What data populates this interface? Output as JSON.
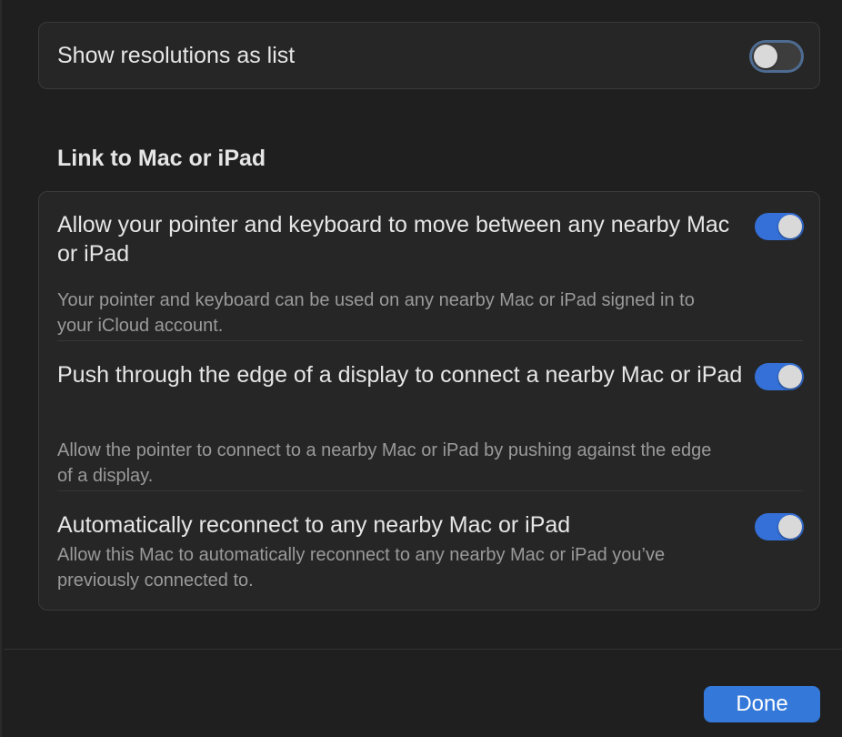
{
  "display": {
    "show_resolutions_label": "Show resolutions as list",
    "show_resolutions_on": false
  },
  "link_section": {
    "title": "Link to Mac or iPad",
    "items": [
      {
        "title": "Allow your pointer and keyboard to move between any nearby Mac or iPad",
        "description": "Your pointer and keyboard can be used on any nearby Mac or iPad signed in to your iCloud account.",
        "on": true
      },
      {
        "title": "Push through the edge of a display to connect a nearby Mac or iPad",
        "description": "Allow the pointer to connect to a nearby Mac or iPad by pushing against the edge of a display.",
        "on": true
      },
      {
        "title": "Automatically reconnect to any nearby Mac or iPad",
        "description": "Allow this Mac to automatically reconnect to any nearby Mac or iPad you’ve previously connected to.",
        "on": true
      }
    ]
  },
  "footer": {
    "done_label": "Done"
  },
  "colors": {
    "accent": "#3478d9",
    "toggle_on": "#3470d8",
    "background": "#1f1f1f",
    "card": "#262626"
  }
}
